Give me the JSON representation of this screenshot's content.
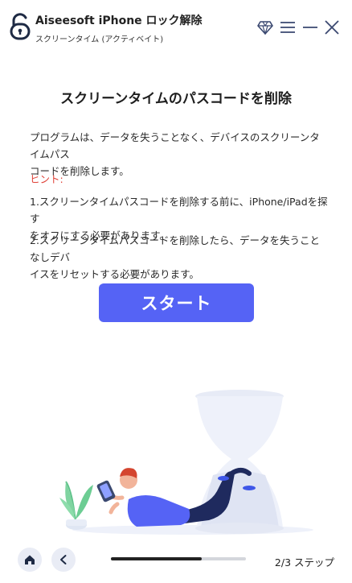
{
  "app": {
    "title": "Aiseesoft iPhone ロック解除",
    "subtitle": "スクリーンタイム (アクティベイト)"
  },
  "icons": {
    "logo": "unlock-padlock-icon",
    "premium": "diamond-icon",
    "menu": "hamburger-menu-icon",
    "minimize": "minimize-icon",
    "close": "close-icon",
    "home": "home-icon",
    "back": "chevron-left-icon"
  },
  "main": {
    "title": "スクリーンタイムのパスコードを削除",
    "description_line1": "プログラムは、データを失うことなく、デバイスのスクリーンタイムパス",
    "description_line2": "コードを削除します。",
    "hint_label": "ヒント:",
    "hint1_line1": "1.スクリーンタイムパスコードを削除する前に、iPhone/iPadを探す",
    "hint1_line2": "をオフにする必要があります。",
    "hint2_line1": "2.スクリーンタイムパスコードを削除したら、データを失うことなしデバ",
    "hint2_line2": "イスをリセットする必要があります。",
    "start_label": "スタート"
  },
  "footer": {
    "progress": 0.67,
    "step_text": "2/3 ステップ"
  },
  "colors": {
    "accent": "#5563f5",
    "hint": "#e0443a",
    "titlebar_icon": "#3a4870"
  }
}
